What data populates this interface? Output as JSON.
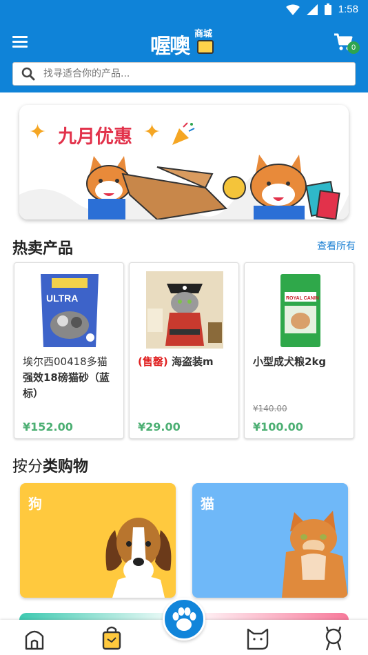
{
  "status_bar": {
    "time": "1:58"
  },
  "header": {
    "logo_main": "喔噢",
    "logo_sub": "商城",
    "cart_count": "0"
  },
  "search": {
    "placeholder": "找寻适合你的产品..."
  },
  "banner": {
    "title": "九月优惠"
  },
  "hot": {
    "title": "热卖产品",
    "see_all": "查看所有",
    "products": [
      {
        "name_part1": "埃尔西00418多猫",
        "name_part2": "强效18磅猫砂（蓝标）",
        "old_price": "",
        "price": "¥152.00"
      },
      {
        "tag": "(售罄)",
        "name": " 海盗装m",
        "old_price": "",
        "price": "¥29.00"
      },
      {
        "name": "小型成犬粮2kg",
        "old_price": "¥140.00",
        "price": "¥100.00"
      }
    ],
    "product_image_text": {
      "p1": "ULTRA",
      "p3": "ROYAL CANIN"
    }
  },
  "categories": {
    "title_a": "按分",
    "title_b": "类购物",
    "items": [
      {
        "label": "狗",
        "color": "#ffc93e"
      },
      {
        "label": "猫",
        "color": "#6fb8f8"
      }
    ]
  },
  "colors": {
    "brand": "#0f83d8",
    "price": "#4caf73",
    "sold_out": "#e02020",
    "link": "#1a7fd3"
  },
  "bottom_nav": [
    "home-icon",
    "shop-bag-icon",
    "paw-icon",
    "cat-icon",
    "user-icon"
  ]
}
